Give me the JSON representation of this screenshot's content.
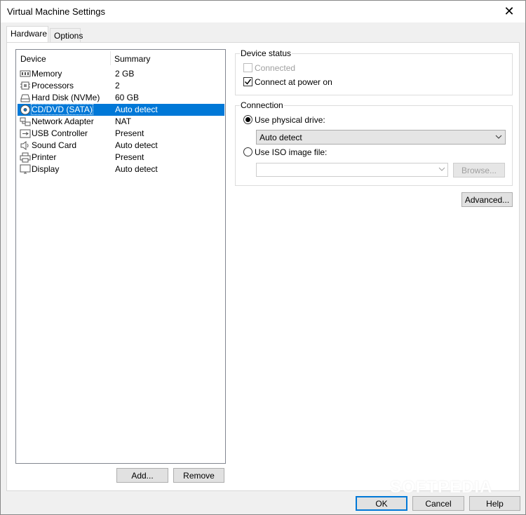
{
  "window": {
    "title": "Virtual Machine Settings",
    "close_glyph": "✕"
  },
  "tabs": [
    {
      "label": "Hardware",
      "active": true
    },
    {
      "label": "Options",
      "active": false
    }
  ],
  "device_list": {
    "headers": {
      "device": "Device",
      "summary": "Summary"
    },
    "rows": [
      {
        "name": "Memory",
        "summary": "2 GB",
        "icon": "memory-icon",
        "selected": false
      },
      {
        "name": "Processors",
        "summary": "2",
        "icon": "processor-icon",
        "selected": false
      },
      {
        "name": "Hard Disk (NVMe)",
        "summary": "60 GB",
        "icon": "hard-disk-icon",
        "selected": false
      },
      {
        "name": "CD/DVD (SATA)",
        "summary": "Auto detect",
        "icon": "cd-dvd-icon",
        "selected": true
      },
      {
        "name": "Network Adapter",
        "summary": "NAT",
        "icon": "network-adapter-icon",
        "selected": false
      },
      {
        "name": "USB Controller",
        "summary": "Present",
        "icon": "usb-icon",
        "selected": false
      },
      {
        "name": "Sound Card",
        "summary": "Auto detect",
        "icon": "speaker-icon",
        "selected": false
      },
      {
        "name": "Printer",
        "summary": "Present",
        "icon": "printer-icon",
        "selected": false
      },
      {
        "name": "Display",
        "summary": "Auto detect",
        "icon": "monitor-icon",
        "selected": false
      }
    ],
    "add_label": "Add...",
    "remove_label": "Remove"
  },
  "device_status": {
    "legend": "Device status",
    "connected": {
      "label": "Connected",
      "checked": false,
      "enabled": false
    },
    "connect_at_power_on": {
      "label": "Connect at power on",
      "checked": true,
      "enabled": true
    }
  },
  "connection": {
    "legend": "Connection",
    "use_physical_drive": {
      "label": "Use physical drive:",
      "selected": true
    },
    "physical_drive_value": "Auto detect",
    "use_iso_image": {
      "label": "Use ISO image file:",
      "selected": false
    },
    "iso_path_value": "",
    "browse_label": "Browse..."
  },
  "advanced_label": "Advanced...",
  "footer": {
    "ok_label": "OK",
    "cancel_label": "Cancel",
    "help_label": "Help"
  },
  "watermark": "SOFTPEDIA",
  "colors": {
    "selection": "#0078d7",
    "default_button_border": "#0078d7"
  }
}
